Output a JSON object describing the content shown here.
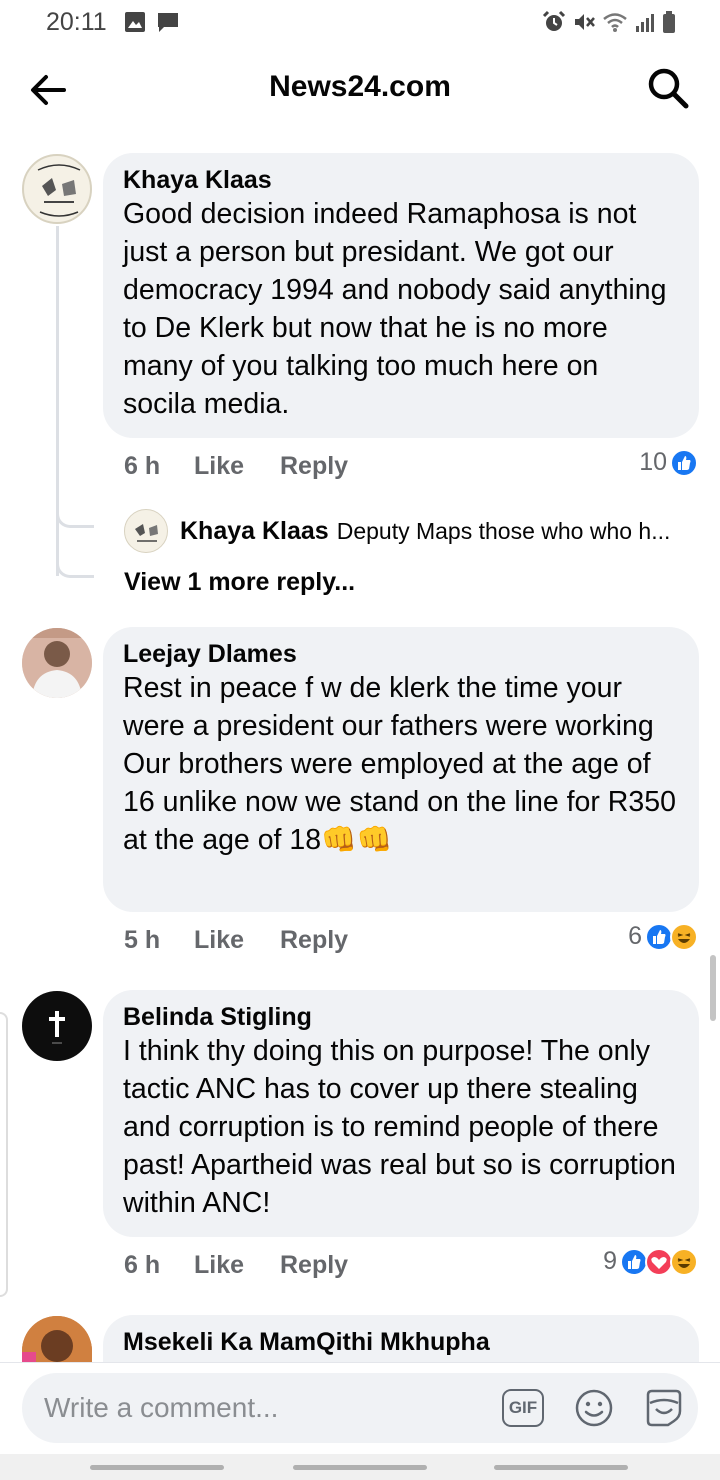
{
  "status_bar": {
    "time": "20:11",
    "left_icons": [
      "image-icon",
      "message-icon"
    ],
    "right_icons": [
      "alarm-icon",
      "mute-icon",
      "wifi-icon",
      "signal-icon",
      "battery-icon"
    ]
  },
  "header": {
    "title": "News24.com",
    "back_icon": "arrow-left-icon",
    "search_icon": "search-icon"
  },
  "comments": [
    {
      "author": "Khaya Klaas",
      "text": "Good decision indeed Ramaphosa is not just a person but presidant. We got our democracy 1994 and nobody said anything to De Klerk but now that he is no more many of you talking too much here on socila media.",
      "time": "6 h",
      "like": "Like",
      "reply": "Reply",
      "reaction_count": "10",
      "reactions": [
        "like"
      ],
      "replies_preview": {
        "author": "Khaya Klaas",
        "text": "Deputy Maps those who who h..."
      },
      "view_more": "View 1 more reply..."
    },
    {
      "author": "Leejay Dlames",
      "text_lines": [
        "Rest in peace f w de klerk the time your were a president our fathers were working",
        "Our brothers were employed at the age of 16 unlike now we stand on the line for R350 at the age of 18👊👊"
      ],
      "time": "5 h",
      "like": "Like",
      "reply": "Reply",
      "reaction_count": "6",
      "reactions": [
        "like",
        "haha"
      ]
    },
    {
      "author": "Belinda Stigling",
      "text": "I think thy doing this on purpose! The only tactic ANC has to cover up there stealing and corruption is to remind people of there past! Apartheid was real but so is corruption within ANC!",
      "time": "6 h",
      "like": "Like",
      "reply": "Reply",
      "reaction_count": "9",
      "reactions": [
        "like",
        "love",
        "haha"
      ]
    },
    {
      "author": "Msekeli Ka MamQithi Mkhupha"
    }
  ],
  "compose": {
    "placeholder": "Write a comment...",
    "gif_label": "GIF"
  },
  "colors": {
    "like_blue": "#1877f2",
    "love_red": "#f33e58",
    "haha_yellow": "#f7b125",
    "bubble_bg": "#f0f2f5",
    "meta_gray": "#65676b"
  }
}
